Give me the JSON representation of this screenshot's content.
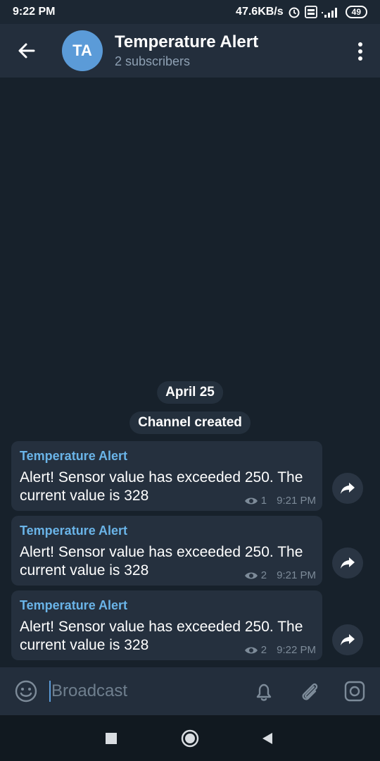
{
  "status_bar": {
    "time": "9:22 PM",
    "network_speed": "47.6KB/s",
    "battery": "49",
    "icons": [
      "alarm-icon",
      "volte-icon",
      "signal-4g-icon",
      "battery-icon"
    ]
  },
  "header": {
    "avatar_initials": "TA",
    "title": "Temperature Alert",
    "subtitle": "2 subscribers",
    "icons": [
      "back-arrow-icon",
      "more-vertical-icon"
    ]
  },
  "chat": {
    "date_label": "April 25",
    "service_message": "Channel created",
    "messages": [
      {
        "author": "Temperature Alert",
        "text": "Alert! Sensor value has exceeded 250. The current value is 328",
        "views": "1",
        "time": "9:21 PM"
      },
      {
        "author": "Temperature Alert",
        "text": "Alert! Sensor value has exceeded 250. The current value is 328",
        "views": "2",
        "time": "9:21 PM"
      },
      {
        "author": "Temperature Alert",
        "text": "Alert! Sensor value has exceeded 250. The current value is 328",
        "views": "2",
        "time": "9:22 PM"
      }
    ]
  },
  "input": {
    "placeholder": "Broadcast",
    "icons": [
      "emoji-icon",
      "bell-icon",
      "attach-icon",
      "camera-icon"
    ]
  },
  "nav_bar": {
    "icons": [
      "square-recent-icon",
      "circle-home-icon",
      "triangle-back-icon"
    ]
  },
  "colors": {
    "background": "#17212b",
    "header": "#232e3c",
    "bubble": "#25303e",
    "accent": "#6ab4e8",
    "avatar": "#5b9bd8"
  }
}
